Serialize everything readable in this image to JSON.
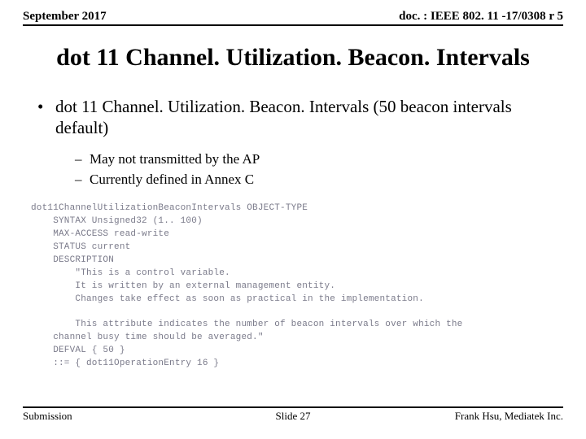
{
  "header": {
    "left": "September 2017",
    "right": "doc. : IEEE 802. 11 -17/0308 r 5"
  },
  "title": "dot 11 Channel. Utilization. Beacon. Intervals",
  "bullet": {
    "text": "dot 11 Channel. Utilization. Beacon. Intervals (50 beacon intervals default)"
  },
  "sub_bullets": [
    "May not transmitted by the AP",
    "Currently defined in Annex C"
  ],
  "code_lines": [
    "dot11ChannelUtilizationBeaconIntervals OBJECT-TYPE",
    "    SYNTAX Unsigned32 (1.. 100)",
    "    MAX-ACCESS read-write",
    "    STATUS current",
    "    DESCRIPTION",
    "        \"This is a control variable.",
    "        It is written by an external management entity.",
    "        Changes take effect as soon as practical in the implementation.",
    "",
    "        This attribute indicates the number of beacon intervals over which the",
    "    channel busy time should be averaged.\"",
    "    DEFVAL { 50 }",
    "    ::= { dot11OperationEntry 16 }"
  ],
  "footer": {
    "left": "Submission",
    "center": "Slide 27",
    "right": "Frank Hsu, Mediatek Inc."
  }
}
